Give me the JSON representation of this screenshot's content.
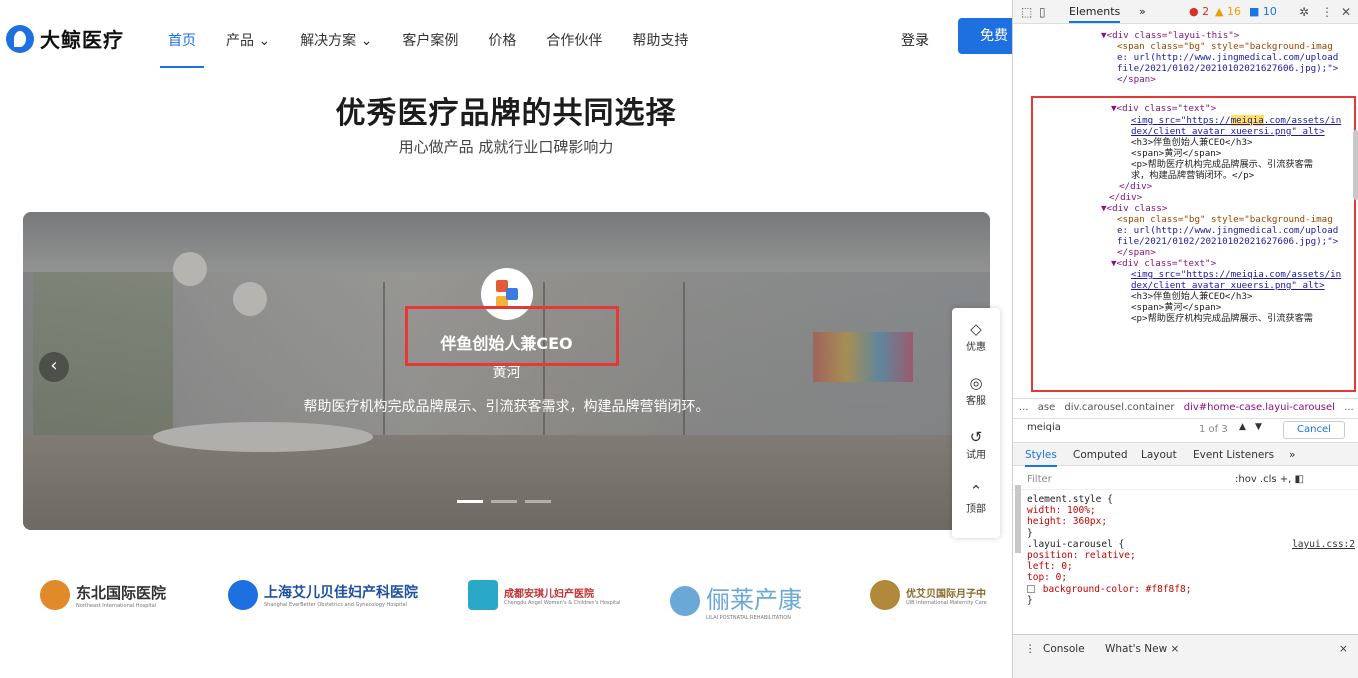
{
  "site": {
    "logo_text": "大鲸医疗",
    "nav": [
      "首页",
      "产品 ⌄",
      "解决方案 ⌄",
      "客户案例",
      "价格",
      "合作伙伴",
      "帮助支持"
    ],
    "login": "登录",
    "free_btn": "免费",
    "title": "优秀医疗品牌的共同选择",
    "subtitle": "用心做产品 成就行业口碑影响力",
    "case": {
      "title": "伴鱼创始人兼CEO",
      "name": "黄河",
      "desc": "帮助医疗机构完成品牌展示、引流获客需求，构建品牌营销闭环。"
    },
    "float_menu": [
      {
        "icon": "◇",
        "label": "优惠"
      },
      {
        "icon": "◎",
        "label": "客服"
      },
      {
        "icon": "↺",
        "label": "试用"
      },
      {
        "icon": "⌃",
        "label": "顶部"
      }
    ],
    "partners": [
      {
        "name": "东北国际医院",
        "sub": "Northeast International Hospital",
        "color": "#e08a2a"
      },
      {
        "name": "上海艾儿贝佳妇产科医院",
        "sub": "Shanghai EverBetter Obstetrics and Gynecology Hospital",
        "color": "#1e6fe0"
      },
      {
        "name": "成都安琪儿妇产医院",
        "sub": "Chengdu Angel Women's & Children's Hospital",
        "color": "#2aa8c8"
      },
      {
        "name": "俪莱产康",
        "sub": "LILAI POSTNATAL REHABILITATION",
        "color": "#6aa8d8"
      },
      {
        "name": "优艾贝国际月子中",
        "sub": "UIB International Maternity Care",
        "color": "#b08a3a"
      }
    ]
  },
  "devtools": {
    "tabs": [
      "Elements",
      "»"
    ],
    "errors": "2",
    "warnings": "16",
    "messages": "10",
    "code_lines": [
      "▼<div class=\"layui-this\">",
      "<span class=\"bg\" style=\"background-imag",
      "e: url(http://www.jingmedical.com/upload",
      "file/2021/0102/20210102021627606.jpg);\">",
      "</span>",
      "▼<div class=\"text\">",
      "<img src=\"https://meiqia.com/assets/in",
      "dex/client_avatar_xueersi.png\" alt>",
      "<h3>伴鱼创始人兼CEO</h3>",
      "<span>黄河</span>",
      "<p>帮助医疗机构完成品牌展示、引流获客需",
      "求，构建品牌营销闭环。</p>",
      "</div>",
      "</div>",
      "▼<div class>",
      "<span class=\"bg\" style=\"background-imag",
      "e: url(http://www.jingmedical.com/upload",
      "file/2021/0102/20210102021627606.jpg);\">",
      "</span>",
      "▼<div class=\"text\">",
      "<img src=\"https://meiqia.com/assets/in",
      "dex/client_avatar_xueersi.png\" alt>",
      "<h3>伴鱼创始人兼CEO</h3>",
      "<span>黄河</span>",
      "<p>帮助医疗机构完成品牌展示、引流获客需"
    ],
    "breadcrumbs": [
      "...",
      "ase",
      "div.carousel.container",
      "div#home-case.layui-carousel",
      "..."
    ],
    "search_value": "meiqia",
    "search_count": "1 of 3",
    "cancel": "Cancel",
    "sub_tabs": [
      "Styles",
      "Computed",
      "Layout",
      "Event Listeners",
      "»"
    ],
    "filter_placeholder": "Filter",
    "filter_tools": ":hov  .cls  +,  ◧",
    "styles": [
      "element.style {",
      "  width: 100%;",
      "  height: 360px;",
      "}",
      ".layui-carousel {",
      "  position: relative;",
      "  left: 0;",
      "  top: 0;",
      "  background-color: #f8f8f8;",
      "}"
    ],
    "rule_source": "layui.css:2",
    "drawer": [
      "⋮",
      "Console",
      "What's New ×",
      "×"
    ]
  }
}
